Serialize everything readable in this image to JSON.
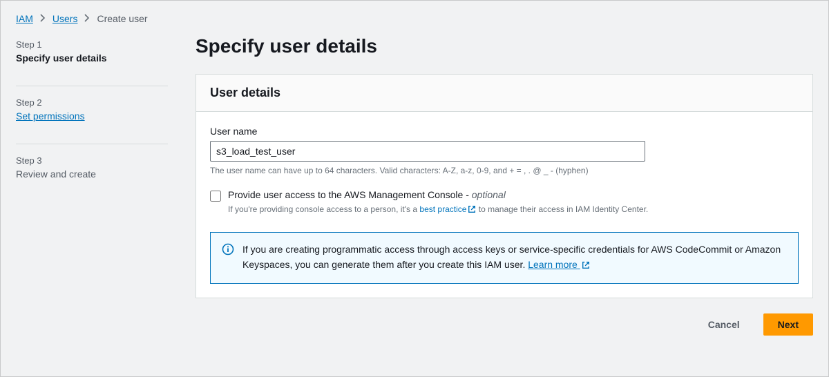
{
  "breadcrumb": {
    "items": [
      {
        "label": "IAM",
        "link": true
      },
      {
        "label": "Users",
        "link": true
      },
      {
        "label": "Create user",
        "link": false
      }
    ]
  },
  "wizard": {
    "steps": [
      {
        "label": "Step 1",
        "title": "Specify user details",
        "state": "active"
      },
      {
        "label": "Step 2",
        "title": "Set permissions",
        "state": "link"
      },
      {
        "label": "Step 3",
        "title": "Review and create",
        "state": "future"
      }
    ]
  },
  "page": {
    "title": "Specify user details"
  },
  "panel": {
    "header": "User details",
    "username": {
      "label": "User name",
      "value": "s3_load_test_user",
      "hint": "The user name can have up to 64 characters. Valid characters: A-Z, a-z, 0-9, and + = , . @ _ - (hyphen)"
    },
    "consoleAccess": {
      "checked": false,
      "label": "Provide user access to the AWS Management Console - ",
      "optional": "optional",
      "descPrefix": "If you're providing console access to a person, it's a ",
      "linkText": "best practice",
      "descSuffix": " to manage their access in IAM Identity Center."
    },
    "info": {
      "text": "If you are creating programmatic access through access keys or service-specific credentials for AWS CodeCommit or Amazon Keyspaces, you can generate them after you create this IAM user. ",
      "link": "Learn more"
    }
  },
  "footer": {
    "cancel": "Cancel",
    "next": "Next"
  }
}
